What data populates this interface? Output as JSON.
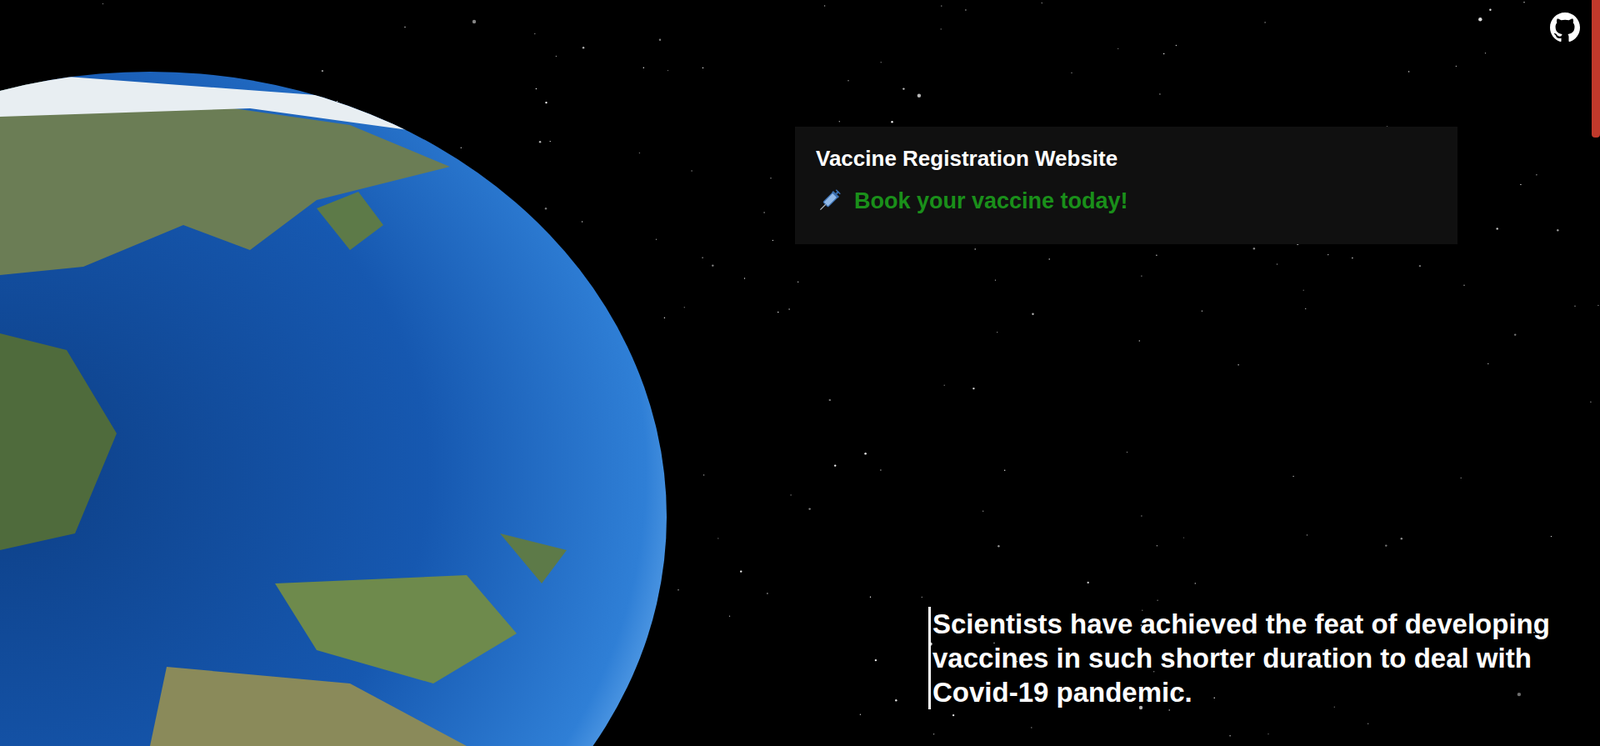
{
  "card": {
    "title": "Vaccine Registration Website",
    "link": "Book your vaccine today!"
  },
  "tagline": "Scientists have achieved the feat of developing vaccines in such shorter duration to deal with Covid-19 pandemic."
}
